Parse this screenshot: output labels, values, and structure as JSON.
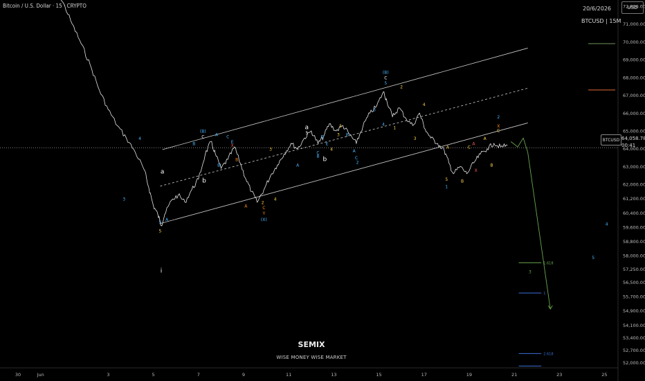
{
  "header": {
    "symbol_title": "Bitcoin / U.S. Dollar · 15 · CRYPTO",
    "date": "20/6/2026",
    "timeframe": "BTCUSD | 15M",
    "currency": "USD"
  },
  "watermark": {
    "title": "SEMIX",
    "subtitle": "WISE MONEY WISE MARKET"
  },
  "price_label": {
    "symbol": "BTCUSD",
    "price": "64,058.78",
    "countdown": "00:41"
  },
  "colors": {
    "background": "#000000",
    "price_line": "#d0d0d0",
    "channel": "#cfcfcf",
    "projection": "#6aa84f",
    "fib_green": "#6aa84f",
    "fib_blue": "#3d6fd8",
    "legend_green": "#5a7a4a",
    "legend_orange": "#b5562a"
  },
  "chart_data": {
    "type": "line",
    "y_axis": {
      "ticks": [
        52000,
        52700,
        53400,
        54100,
        54900,
        55700,
        56500,
        57250,
        58000,
        58800,
        59600,
        60400,
        61200,
        62000,
        63000,
        64000,
        65000,
        66000,
        67000,
        68000,
        69000,
        70000,
        71000,
        72000
      ],
      "tick_labels": [
        "52,000.00",
        "52,700.00",
        "53,400.00",
        "54,100.00",
        "54,900.00",
        "55,700.00",
        "56,500.00",
        "57,250.00",
        "58,000.00",
        "58,800.00",
        "59,600.00",
        "60,400.00",
        "61,200.00",
        "62,000.00",
        "63,000.00",
        "64,000.00",
        "65,000.00",
        "66,000.00",
        "67,000.00",
        "68,000.00",
        "69,000.00",
        "70,000.00",
        "71,000.00",
        "72,000.00"
      ]
    },
    "x_axis": {
      "ticks": [
        0,
        1,
        4,
        6,
        8,
        10,
        12,
        14,
        16,
        18,
        20,
        22,
        24,
        26
      ],
      "tick_labels": [
        "30",
        "Jun",
        "3",
        "5",
        "7",
        "9",
        "11",
        "13",
        "15",
        "17",
        "19",
        "21",
        "23",
        "25"
      ]
    },
    "xlim": [
      -0.8,
      26.6
    ],
    "ylim": [
      51700,
      72350
    ],
    "current_price": 64058.78,
    "price": [
      [
        -0.8,
        73300
      ],
      [
        1.4,
        73000
      ],
      [
        2.0,
        72200
      ],
      [
        2.4,
        71000
      ],
      [
        2.8,
        69900
      ],
      [
        3.2,
        68700
      ],
      [
        3.6,
        67300
      ],
      [
        4.0,
        66200
      ],
      [
        4.4,
        65300
      ],
      [
        4.8,
        64600
      ],
      [
        5.2,
        63800
      ],
      [
        5.6,
        62800
      ],
      [
        5.8,
        61800
      ],
      [
        6.0,
        60800
      ],
      [
        6.2,
        60300
      ],
      [
        6.35,
        59700
      ],
      [
        6.5,
        60300
      ],
      [
        6.8,
        61100
      ],
      [
        7.1,
        61400
      ],
      [
        7.4,
        61000
      ],
      [
        7.7,
        61700
      ],
      [
        8.0,
        62300
      ],
      [
        8.3,
        63700
      ],
      [
        8.55,
        64400
      ],
      [
        8.75,
        63700
      ],
      [
        9.0,
        62900
      ],
      [
        9.3,
        63400
      ],
      [
        9.6,
        64100
      ],
      [
        9.85,
        63200
      ],
      [
        10.1,
        62300
      ],
      [
        10.35,
        61600
      ],
      [
        10.6,
        61000
      ],
      [
        10.9,
        61700
      ],
      [
        11.2,
        62500
      ],
      [
        11.5,
        63100
      ],
      [
        11.8,
        63700
      ],
      [
        12.1,
        64300
      ],
      [
        12.4,
        64000
      ],
      [
        12.7,
        64600
      ],
      [
        13.0,
        65000
      ],
      [
        13.3,
        64300
      ],
      [
        13.55,
        64700
      ],
      [
        13.8,
        65400
      ],
      [
        14.1,
        65000
      ],
      [
        14.4,
        65300
      ],
      [
        14.7,
        64800
      ],
      [
        15.0,
        64300
      ],
      [
        15.3,
        65300
      ],
      [
        15.6,
        66000
      ],
      [
        15.9,
        66400
      ],
      [
        16.2,
        67200
      ],
      [
        16.35,
        66700
      ],
      [
        16.6,
        65800
      ],
      [
        16.9,
        66300
      ],
      [
        17.2,
        65700
      ],
      [
        17.5,
        65300
      ],
      [
        17.8,
        66000
      ],
      [
        18.05,
        65100
      ],
      [
        18.3,
        64600
      ],
      [
        18.6,
        64300
      ],
      [
        18.9,
        63900
      ],
      [
        19.1,
        63200
      ],
      [
        19.3,
        62600
      ],
      [
        19.6,
        63000
      ],
      [
        19.9,
        62600
      ],
      [
        20.2,
        63200
      ],
      [
        20.5,
        63700
      ],
      [
        20.8,
        64000
      ],
      [
        21.1,
        64300
      ],
      [
        21.4,
        64100
      ],
      [
        21.7,
        64200
      ]
    ],
    "projection": [
      [
        21.85,
        64400
      ],
      [
        22.15,
        64100
      ],
      [
        22.4,
        64600
      ],
      [
        22.6,
        63800
      ],
      [
        23.6,
        55000
      ]
    ],
    "fib_levels": [
      {
        "y": 57600,
        "x_start": 22.2,
        "x_end": 23.2,
        "label": "1.618",
        "tone": "green"
      },
      {
        "y": 55900,
        "x_start": 22.2,
        "x_end": 23.2,
        "label": "1",
        "tone": "blue"
      },
      {
        "y": 52500,
        "x_start": 22.2,
        "x_end": 23.2,
        "label": "2.618",
        "tone": "blue"
      },
      {
        "y": 51800,
        "x_start": 22.2,
        "x_end": 23.2,
        "label": "",
        "tone": "blue"
      }
    ],
    "channel_lines": [
      {
        "from": [
          6.3,
          59800
        ],
        "to": [
          22.6,
          65450
        ],
        "style": "solid"
      },
      {
        "from": [
          6.4,
          63950
        ],
        "to": [
          22.6,
          69650
        ],
        "style": "solid"
      },
      {
        "from": [
          6.3,
          61900
        ],
        "to": [
          22.6,
          67400
        ],
        "style": "dashed"
      }
    ],
    "legend_swatches": [
      {
        "y": 69900,
        "tone": "legend_green"
      },
      {
        "y": 67300,
        "tone": "legend_orange"
      }
    ],
    "wave_labels": [
      {
        "x": 6.3,
        "y": 59800,
        "text": "5",
        "color": "#4db6ff"
      },
      {
        "x": 6.3,
        "y": 59300,
        "text": "5",
        "color": "#ffd54a"
      },
      {
        "x": 6.6,
        "y": 59950,
        "text": "A",
        "color": "#4db6ff"
      },
      {
        "x": 6.35,
        "y": 57050,
        "text": "i",
        "color": "#ffffff"
      },
      {
        "x": 6.4,
        "y": 62600,
        "text": "a",
        "color": "#ffffff"
      },
      {
        "x": 4.7,
        "y": 61100,
        "text": "3",
        "color": "#4db6ff"
      },
      {
        "x": 5.4,
        "y": 64500,
        "text": "4",
        "color": "#4db6ff"
      },
      {
        "x": 8.2,
        "y": 64900,
        "text": "(B)",
        "color": "#4db6ff"
      },
      {
        "x": 8.2,
        "y": 64600,
        "text": "C",
        "color": "#ffffff"
      },
      {
        "x": 8.25,
        "y": 62100,
        "text": "b",
        "color": "#ffffff"
      },
      {
        "x": 8.8,
        "y": 64700,
        "text": "A",
        "color": "#4db6ff"
      },
      {
        "x": 7.8,
        "y": 64200,
        "text": "B",
        "color": "#4db6ff"
      },
      {
        "x": 9.3,
        "y": 64600,
        "text": "C",
        "color": "#4db6ff"
      },
      {
        "x": 9.5,
        "y": 64300,
        "text": "E",
        "color": "#4db6ff"
      },
      {
        "x": 9.5,
        "y": 64100,
        "text": "X",
        "color": "#ff5a5a"
      },
      {
        "x": 8.9,
        "y": 63000,
        "text": "B",
        "color": "#4db6ff"
      },
      {
        "x": 9.7,
        "y": 63300,
        "text": "B",
        "color": "#ff8c1a"
      },
      {
        "x": 11.2,
        "y": 63900,
        "text": "3",
        "color": "#ffd54a"
      },
      {
        "x": 10.1,
        "y": 60700,
        "text": "A",
        "color": "#ff8c1a"
      },
      {
        "x": 10.85,
        "y": 60900,
        "text": "2",
        "color": "#ffd54a"
      },
      {
        "x": 10.9,
        "y": 60600,
        "text": "C",
        "color": "#ff8c1a"
      },
      {
        "x": 10.9,
        "y": 60300,
        "text": "Y",
        "color": "#ff8c1a"
      },
      {
        "x": 10.9,
        "y": 59950,
        "text": "(X)",
        "color": "#4db6ff"
      },
      {
        "x": 11.4,
        "y": 61100,
        "text": "4",
        "color": "#ffd54a"
      },
      {
        "x": 12.8,
        "y": 65100,
        "text": "a",
        "color": "#ffffff"
      },
      {
        "x": 12.8,
        "y": 64800,
        "text": "5",
        "color": "#ffffff"
      },
      {
        "x": 13.5,
        "y": 64600,
        "text": "D",
        "color": "#4db6ff"
      },
      {
        "x": 13.7,
        "y": 64200,
        "text": "E",
        "color": "#4db6ff"
      },
      {
        "x": 14.2,
        "y": 64700,
        "text": "3",
        "color": "#ffd54a"
      },
      {
        "x": 14.3,
        "y": 65200,
        "text": "5",
        "color": "#ffd54a"
      },
      {
        "x": 14.6,
        "y": 64700,
        "text": "B",
        "color": "#4db6ff"
      },
      {
        "x": 13.9,
        "y": 63900,
        "text": "4",
        "color": "#ffd54a"
      },
      {
        "x": 13.3,
        "y": 63700,
        "text": "C",
        "color": "#4db6ff"
      },
      {
        "x": 13.3,
        "y": 63500,
        "text": "B",
        "color": "#4db6ff"
      },
      {
        "x": 13.6,
        "y": 63300,
        "text": "b",
        "color": "#ffffff"
      },
      {
        "x": 14.9,
        "y": 63800,
        "text": "A",
        "color": "#4db6ff"
      },
      {
        "x": 15.0,
        "y": 63400,
        "text": "C",
        "color": "#4db6ff"
      },
      {
        "x": 15.05,
        "y": 63150,
        "text": "2",
        "color": "#4db6ff"
      },
      {
        "x": 12.4,
        "y": 63000,
        "text": "A",
        "color": "#4db6ff"
      },
      {
        "x": 15.8,
        "y": 66100,
        "text": "3",
        "color": "#4db6ff"
      },
      {
        "x": 16.3,
        "y": 68200,
        "text": "(B)",
        "color": "#4db6ff"
      },
      {
        "x": 16.3,
        "y": 67900,
        "text": "C",
        "color": "#ffffff"
      },
      {
        "x": 16.3,
        "y": 67600,
        "text": "5",
        "color": "#4db6ff"
      },
      {
        "x": 17.0,
        "y": 67400,
        "text": "2",
        "color": "#ffd54a"
      },
      {
        "x": 16.2,
        "y": 65300,
        "text": "4",
        "color": "#4db6ff"
      },
      {
        "x": 16.7,
        "y": 65100,
        "text": "1",
        "color": "#ffd54a"
      },
      {
        "x": 18.0,
        "y": 66400,
        "text": "4",
        "color": "#ffd54a"
      },
      {
        "x": 17.6,
        "y": 64500,
        "text": "3",
        "color": "#ffd54a"
      },
      {
        "x": 19.0,
        "y": 62200,
        "text": "5",
        "color": "#ffd54a"
      },
      {
        "x": 19.0,
        "y": 61800,
        "text": "1",
        "color": "#4db6ff"
      },
      {
        "x": 19.05,
        "y": 64000,
        "text": "A",
        "color": "#ffd54a"
      },
      {
        "x": 19.7,
        "y": 62100,
        "text": "B",
        "color": "#ffd54a"
      },
      {
        "x": 20.2,
        "y": 64200,
        "text": "A",
        "color": "#ff5a5a"
      },
      {
        "x": 20.0,
        "y": 64000,
        "text": "C",
        "color": "#ffd54a"
      },
      {
        "x": 20.3,
        "y": 62700,
        "text": "X",
        "color": "#ff5a5a"
      },
      {
        "x": 20.7,
        "y": 64500,
        "text": "A",
        "color": "#ffd54a"
      },
      {
        "x": 21.0,
        "y": 63000,
        "text": "B",
        "color": "#ffd54a"
      },
      {
        "x": 21.3,
        "y": 65700,
        "text": "2",
        "color": "#4db6ff"
      },
      {
        "x": 21.3,
        "y": 65200,
        "text": "X",
        "color": "#ff8c1a"
      },
      {
        "x": 21.3,
        "y": 64950,
        "text": "C",
        "color": "#ffd54a"
      },
      {
        "x": 22.7,
        "y": 57000,
        "text": "3",
        "color": "#6aa84f"
      },
      {
        "x": 25.5,
        "y": 57800,
        "text": "5",
        "color": "#4db6ff"
      },
      {
        "x": 26.1,
        "y": 59700,
        "text": "4",
        "color": "#4db6ff"
      }
    ]
  }
}
